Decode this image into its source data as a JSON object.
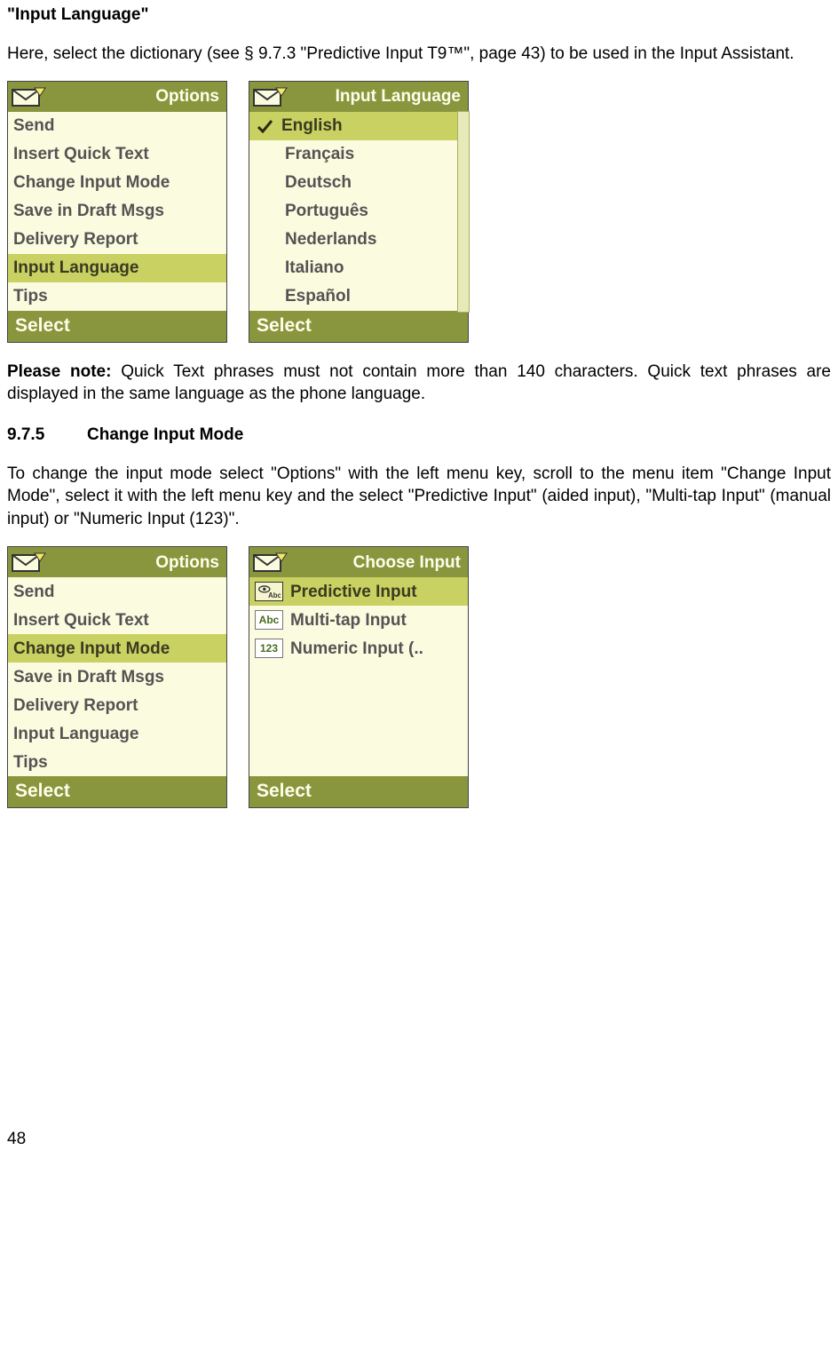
{
  "heading_input_language": "\"Input Language\"",
  "intro_paragraph": "Here, select the dictionary (see § 9.7.3 \"Predictive Input T9™\", page 43) to be used in the Input Assistant.",
  "note_label": "Please note:",
  "note_body": " Quick Text phrases must not contain more than 140 characters. Quick text phrases are displayed in the same language as the phone language.",
  "section_number": "9.7.5",
  "section_title": "Change Input Mode",
  "section_paragraph": "To change the input mode select \"Options\" with the left menu key, scroll to the menu item \"Change Input Mode\", select it with the left menu key and the select \"Predictive Input\" (aided input), \"Multi-tap Input\" (manual input) or \"Numeric Input (123)\".",
  "softkey_select": "Select",
  "screens_row1": {
    "left": {
      "title": "Options",
      "items": [
        {
          "label": "Send",
          "selected": false
        },
        {
          "label": "Insert Quick Text",
          "selected": false
        },
        {
          "label": "Change Input Mode",
          "selected": false
        },
        {
          "label": "Save in Draft Msgs",
          "selected": false
        },
        {
          "label": "Delivery Report",
          "selected": false
        },
        {
          "label": "Input Language",
          "selected": true
        },
        {
          "label": "Tips",
          "selected": false
        }
      ]
    },
    "right": {
      "title": "Input Language",
      "items": [
        {
          "label": "English",
          "selected": true,
          "checked": true
        },
        {
          "label": "Français",
          "selected": false
        },
        {
          "label": "Deutsch",
          "selected": false
        },
        {
          "label": "Português",
          "selected": false
        },
        {
          "label": "Nederlands",
          "selected": false
        },
        {
          "label": "Italiano",
          "selected": false
        },
        {
          "label": "Español",
          "selected": false
        }
      ]
    }
  },
  "screens_row2": {
    "left": {
      "title": "Options",
      "items": [
        {
          "label": "Send",
          "selected": false
        },
        {
          "label": "Insert Quick Text",
          "selected": false
        },
        {
          "label": "Change Input Mode",
          "selected": true
        },
        {
          "label": "Save in Draft Msgs",
          "selected": false
        },
        {
          "label": "Delivery Report",
          "selected": false
        },
        {
          "label": "Input Language",
          "selected": false
        },
        {
          "label": "Tips",
          "selected": false
        }
      ]
    },
    "right": {
      "title": "Choose Input",
      "items": [
        {
          "label": "Predictive Input",
          "selected": true,
          "icon_text": "Abc",
          "icon_eye": true
        },
        {
          "label": "Multi-tap Input",
          "selected": false,
          "icon_text": "Abc",
          "icon_eye": false
        },
        {
          "label": "Numeric Input (..",
          "selected": false,
          "icon_text": "123",
          "icon_eye": false
        }
      ]
    }
  },
  "page_number": "48"
}
